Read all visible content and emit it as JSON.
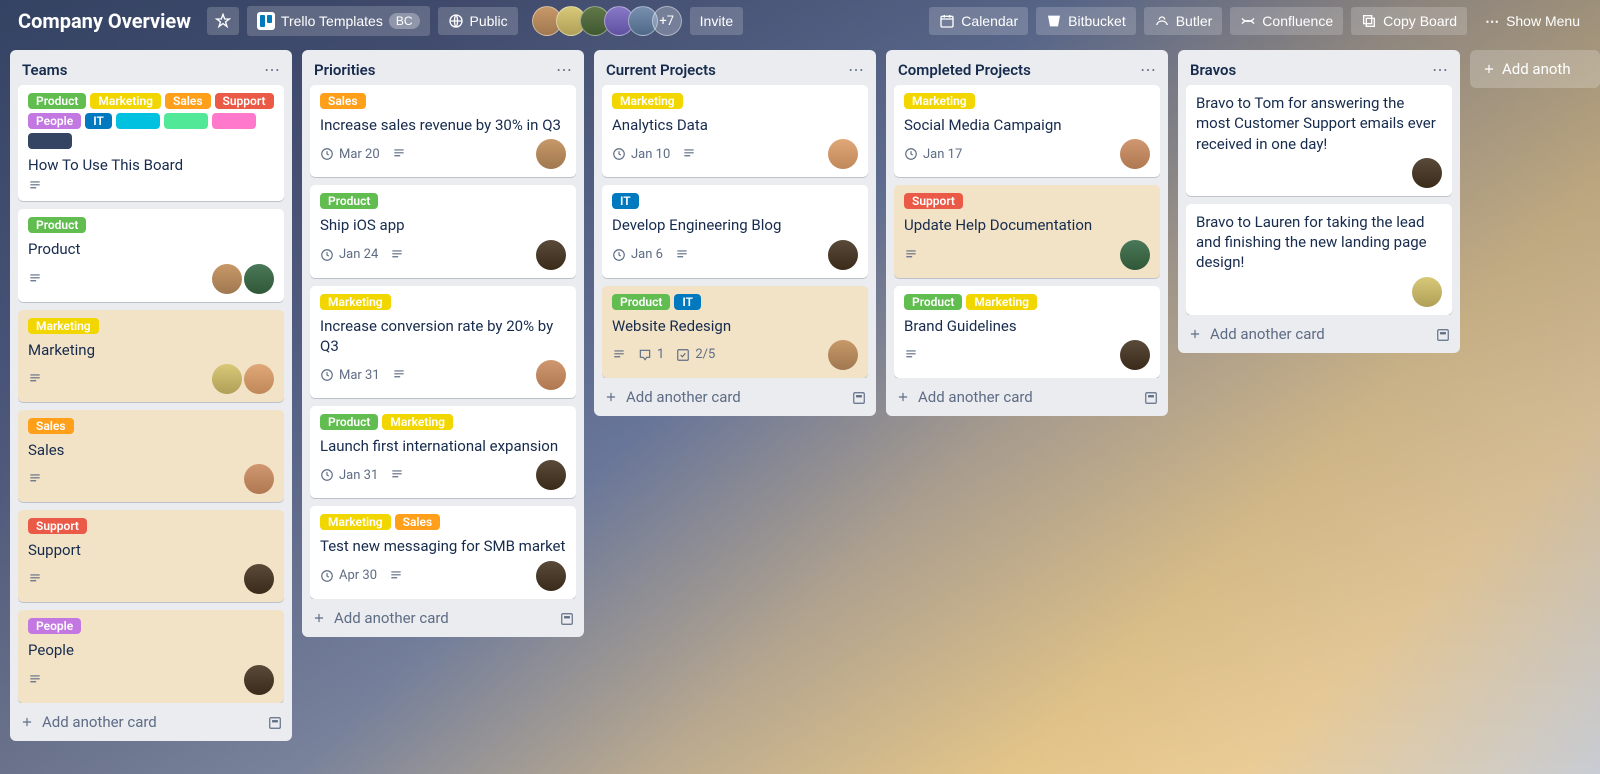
{
  "header": {
    "board_name": "Company Overview",
    "team_name": "Trello Templates",
    "team_initials": "BC",
    "visibility": "Public",
    "extra_members": "+7",
    "invite": "Invite",
    "buttons": {
      "calendar": "Calendar",
      "bitbucket": "Bitbucket",
      "butler": "Butler",
      "confluence": "Confluence",
      "copy_board": "Copy Board",
      "show_menu": "Show Menu"
    }
  },
  "lists": [
    {
      "title": "Teams",
      "cards": [
        {
          "labels": [
            {
              "text": "Product",
              "cls": "lbl-green"
            },
            {
              "text": "Marketing",
              "cls": "lbl-yellow"
            },
            {
              "text": "Sales",
              "cls": "lbl-orange"
            },
            {
              "text": "Support",
              "cls": "lbl-red"
            },
            {
              "text": "People",
              "cls": "lbl-purple"
            },
            {
              "text": "IT",
              "cls": "lbl-blue"
            },
            {
              "text": "",
              "cls": "lbl-sky lbl-bare"
            },
            {
              "text": "",
              "cls": "lbl-lime lbl-bare"
            },
            {
              "text": "",
              "cls": "lbl-pink lbl-bare"
            },
            {
              "text": "",
              "cls": "lbl-navy lbl-bare"
            }
          ],
          "title": "How To Use This Board",
          "has_desc": true
        },
        {
          "labels": [
            {
              "text": "Product",
              "cls": "lbl-green"
            }
          ],
          "title": "Product",
          "has_desc": true,
          "members": [
            "av1",
            "av9"
          ]
        },
        {
          "cover": true,
          "labels": [
            {
              "text": "Marketing",
              "cls": "lbl-yellow"
            }
          ],
          "title": "Marketing",
          "has_desc": true,
          "members": [
            "av2",
            "av8"
          ]
        },
        {
          "cover": true,
          "labels": [
            {
              "text": "Sales",
              "cls": "lbl-orange"
            }
          ],
          "title": "Sales",
          "has_desc": true,
          "members": [
            "av6"
          ]
        },
        {
          "cover": true,
          "labels": [
            {
              "text": "Support",
              "cls": "lbl-red"
            }
          ],
          "title": "Support",
          "has_desc": true,
          "members": [
            "av7"
          ]
        },
        {
          "cover": true,
          "labels": [
            {
              "text": "People",
              "cls": "lbl-purple"
            }
          ],
          "title": "People",
          "has_desc": true,
          "members": [
            "av7"
          ]
        }
      ]
    },
    {
      "title": "Priorities",
      "cards": [
        {
          "labels": [
            {
              "text": "Sales",
              "cls": "lbl-orange"
            }
          ],
          "title": "Increase sales revenue by 30% in Q3",
          "date": "Mar 20",
          "has_desc": true,
          "members": [
            "av1"
          ]
        },
        {
          "labels": [
            {
              "text": "Product",
              "cls": "lbl-green"
            }
          ],
          "title": "Ship iOS app",
          "date": "Jan 24",
          "has_desc": true,
          "members": [
            "av7"
          ]
        },
        {
          "labels": [
            {
              "text": "Marketing",
              "cls": "lbl-yellow"
            }
          ],
          "title": "Increase conversion rate by 20% by Q3",
          "date": "Mar 31",
          "has_desc": true,
          "members": [
            "av6"
          ]
        },
        {
          "labels": [
            {
              "text": "Product",
              "cls": "lbl-green"
            },
            {
              "text": "Marketing",
              "cls": "lbl-yellow"
            }
          ],
          "title": "Launch first international expansion",
          "date": "Jan 31",
          "has_desc": true,
          "members": [
            "av7"
          ]
        },
        {
          "labels": [
            {
              "text": "Marketing",
              "cls": "lbl-yellow"
            },
            {
              "text": "Sales",
              "cls": "lbl-orange"
            }
          ],
          "title": "Test new messaging for SMB market",
          "date": "Apr 30",
          "has_desc": true,
          "members": [
            "av7"
          ]
        }
      ]
    },
    {
      "title": "Current Projects",
      "cards": [
        {
          "labels": [
            {
              "text": "Marketing",
              "cls": "lbl-yellow"
            }
          ],
          "title": "Analytics Data",
          "date": "Jan 10",
          "has_desc": true,
          "members": [
            "av8"
          ]
        },
        {
          "labels": [
            {
              "text": "IT",
              "cls": "lbl-blue"
            }
          ],
          "title": "Develop Engineering Blog",
          "date": "Jan 6",
          "has_desc": true,
          "members": [
            "av7"
          ]
        },
        {
          "cover": true,
          "labels": [
            {
              "text": "Product",
              "cls": "lbl-green"
            },
            {
              "text": "IT",
              "cls": "lbl-blue"
            }
          ],
          "title": "Website Redesign",
          "has_desc": true,
          "comments": "1",
          "checklist": "2/5",
          "members": [
            "av1"
          ]
        }
      ]
    },
    {
      "title": "Completed Projects",
      "cards": [
        {
          "labels": [
            {
              "text": "Marketing",
              "cls": "lbl-yellow"
            }
          ],
          "title": "Social Media Campaign",
          "date": "Jan 17",
          "members": [
            "av6"
          ]
        },
        {
          "cover": true,
          "labels": [
            {
              "text": "Support",
              "cls": "lbl-red"
            }
          ],
          "title": "Update Help Documentation",
          "has_desc": true,
          "members": [
            "av9"
          ]
        },
        {
          "labels": [
            {
              "text": "Product",
              "cls": "lbl-green"
            },
            {
              "text": "Marketing",
              "cls": "lbl-yellow"
            }
          ],
          "title": "Brand Guidelines",
          "has_desc": true,
          "members": [
            "av7"
          ]
        }
      ]
    },
    {
      "title": "Bravos",
      "cards": [
        {
          "title": "Bravo to Tom for answering the most Customer Support emails ever received in one day!",
          "members": [
            "av7"
          ]
        },
        {
          "title": "Bravo to Lauren for taking the lead and finishing the new landing page design!",
          "members": [
            "av2"
          ]
        }
      ]
    }
  ],
  "add_card_label": "Add another card",
  "add_list_label": "Add anoth"
}
